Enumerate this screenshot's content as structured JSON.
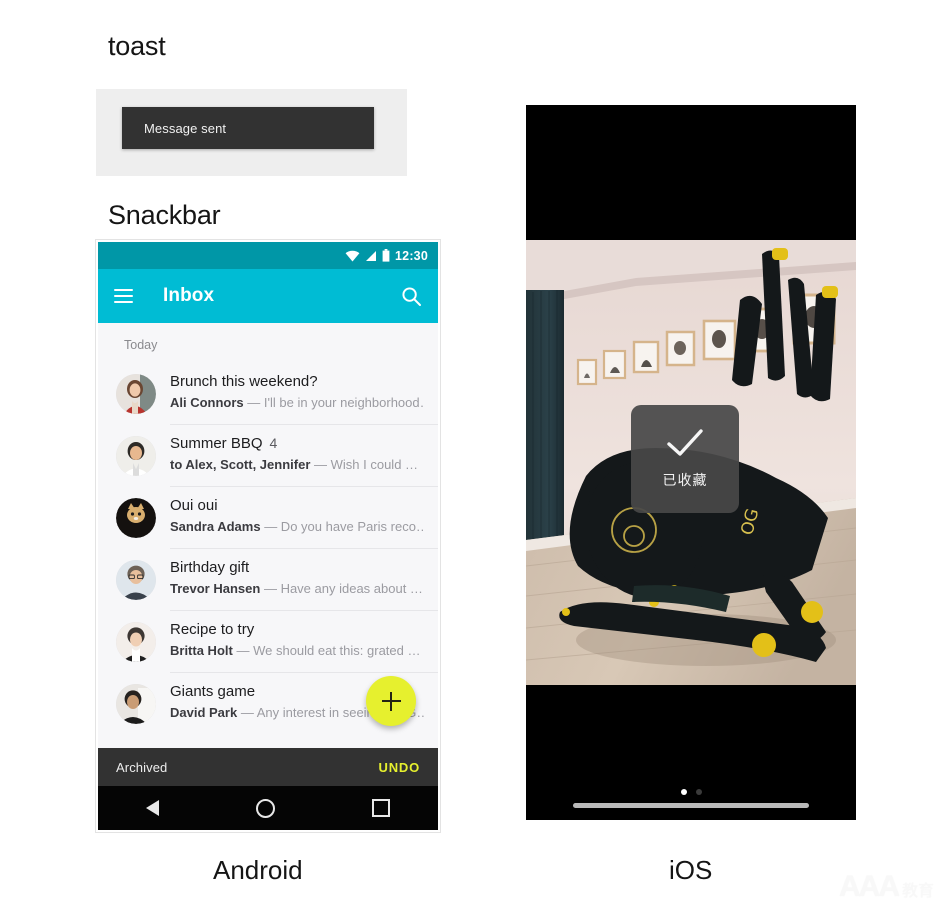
{
  "headings": {
    "toast": "toast",
    "snackbar": "Snackbar"
  },
  "toast_demo": {
    "message": "Message sent",
    "bubble_color": "#323232",
    "panel_color": "#eeeeee"
  },
  "android": {
    "caption": "Android",
    "accent_color": "#00bcd4",
    "status_bar": {
      "time": "12:30",
      "icons": [
        "wifi-icon",
        "signal-icon",
        "battery-icon"
      ],
      "color": "#0097a7"
    },
    "app_bar": {
      "menu_icon": "hamburger-menu-icon",
      "title": "Inbox",
      "search_icon": "search-icon"
    },
    "list": {
      "section_label": "Today",
      "items": [
        {
          "subject": "Brunch this weekend?",
          "count": "",
          "sender": "Ali Connors",
          "preview": "— I'll be in your neighborhood…"
        },
        {
          "subject": "Summer BBQ",
          "count": "4",
          "sender": "to Alex, Scott, Jennifer",
          "preview": "— Wish I could …"
        },
        {
          "subject": "Oui oui",
          "count": "",
          "sender": "Sandra Adams",
          "preview": "— Do you have Paris reco…"
        },
        {
          "subject": "Birthday gift",
          "count": "",
          "sender": "Trevor Hansen",
          "preview": "— Have any ideas about …"
        },
        {
          "subject": "Recipe to try",
          "count": "",
          "sender": "Britta Holt",
          "preview": "— We should eat this: grated …"
        },
        {
          "subject": "Giants game",
          "count": "",
          "sender": "David Park",
          "preview": "— Any interest in seeing the G…"
        }
      ]
    },
    "fab": {
      "icon": "plus-icon",
      "color": "#e6f02e"
    },
    "snackbar": {
      "message": "Archived",
      "action": "UNDO",
      "action_color": "#e6f02e",
      "background": "#323232"
    },
    "nav_bar": {
      "back": "back-triangle-icon",
      "home": "home-circle-icon",
      "recents": "recents-square-icon"
    }
  },
  "ios": {
    "caption": "iOS",
    "toast": {
      "icon": "checkmark-icon",
      "label": "已收藏",
      "background": "rgba(72,72,72,0.93)"
    },
    "page_dots": {
      "total": 2,
      "active_index": 0
    },
    "home_indicator": "home-indicator-bar"
  },
  "watermark": {
    "logo": "AAA",
    "text": "教育"
  }
}
